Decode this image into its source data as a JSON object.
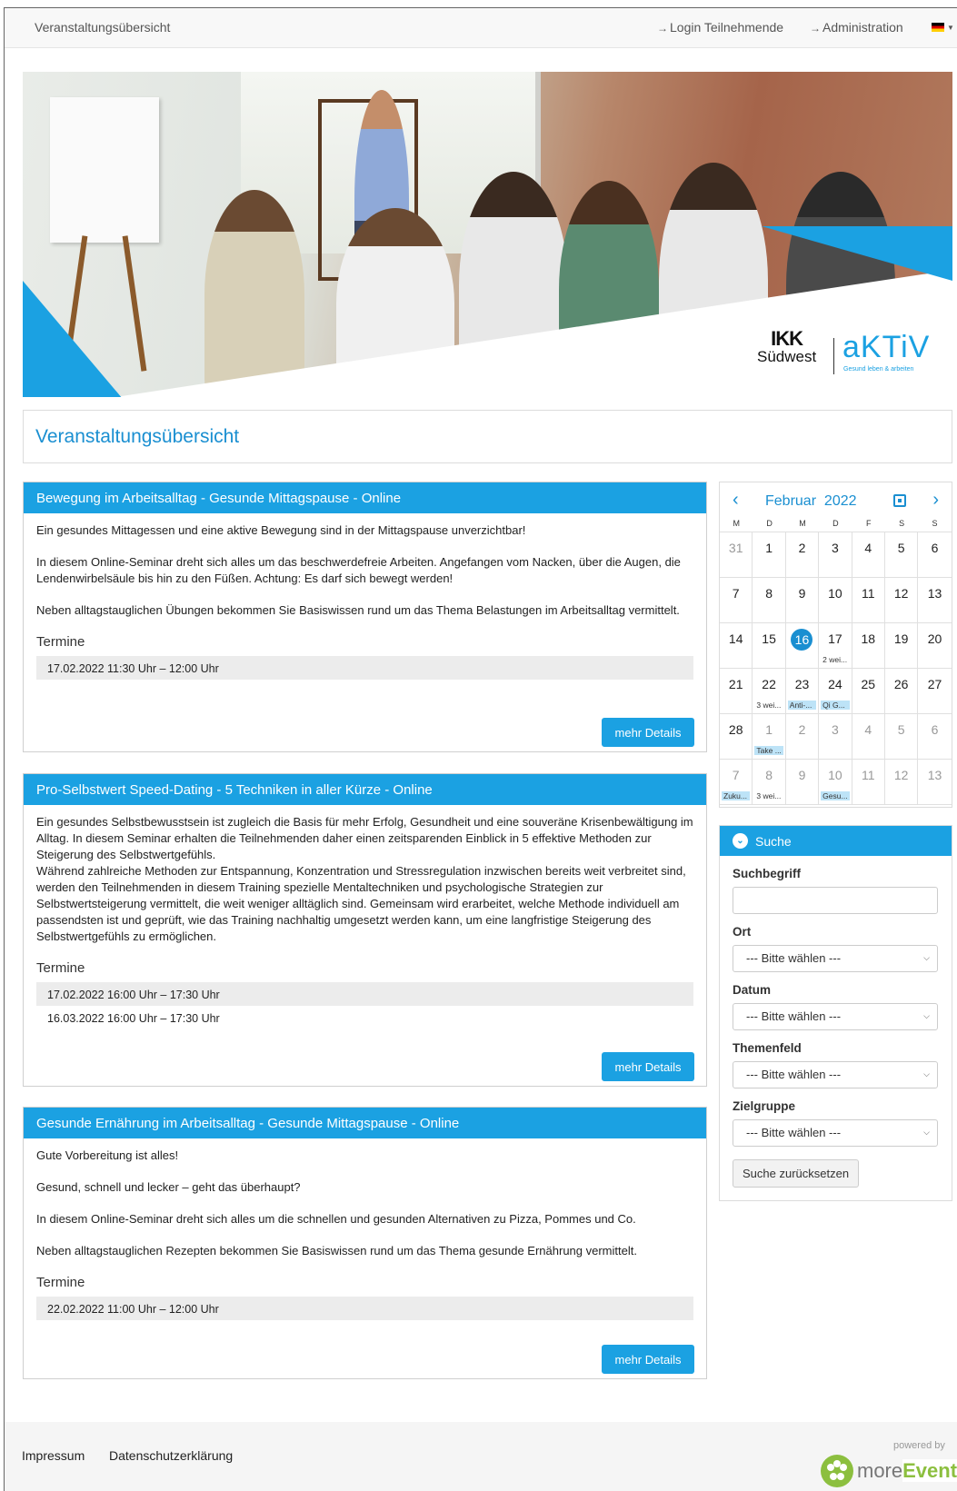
{
  "nav": {
    "brand": "Veranstaltungsübersicht",
    "login": "Login Teilnehmende",
    "admin": "Administration"
  },
  "hero": {
    "logo_ikk": "IKK",
    "logo_sudwest": "Südwest",
    "logo_aktiv": "aKTiV",
    "logo_tagline": "Gesund leben & arbeiten"
  },
  "page_title": "Veranstaltungsübersicht",
  "events": [
    {
      "title": "Bewegung im Arbeitsalltag - Gesunde Mittagspause - Online",
      "paragraphs": [
        "Ein gesundes Mittagessen und eine aktive Bewegung sind in der Mittagspause unverzichtbar!",
        "In diesem Online-Seminar dreht sich alles um das beschwerdefreie Arbeiten. Angefangen vom Nacken, über die Augen, die Lendenwirbelsäule bis hin zu den Füßen. Achtung: Es darf sich bewegt werden!",
        "Neben alltagstauglichen Übungen bekommen Sie Basiswissen rund um das Thema Belastungen im Arbeitsalltag vermittelt."
      ],
      "termine_label": "Termine",
      "termine": [
        "17.02.2022 11:30 Uhr – 12:00 Uhr"
      ],
      "button": "mehr Details"
    },
    {
      "title": "Pro-Selbstwert Speed-Dating - 5 Techniken in aller Kürze - Online",
      "paragraphs": [
        "Ein gesundes Selbstbewusstsein ist zugleich die Basis für mehr Erfolg, Gesundheit und eine souveräne Krisenbewältigung im Alltag. In diesem Seminar erhalten die Teilnehmenden daher einen zeitsparenden Einblick in 5 effektive Methoden zur Steigerung des Selbstwertgefühls.",
        "Während zahlreiche Methoden zur Entspannung, Konzentration und Stressregulation inzwischen bereits weit verbreitet sind, werden den Teilnehmenden in diesem Training spezielle Mentaltechniken und psychologische Strategien zur Selbstwertsteigerung vermittelt, die weit weniger alltäglich sind. Gemeinsam wird erarbeitet, welche Methode individuell am passendsten ist und geprüft, wie das Training nachhaltig umgesetzt werden kann, um eine langfristige Steigerung des Selbstwertgefühls zu ermöglichen."
      ],
      "termine_label": "Termine",
      "termine": [
        "17.02.2022 16:00 Uhr – 17:30 Uhr",
        "16.03.2022 16:00 Uhr – 17:30 Uhr"
      ],
      "button": "mehr Details"
    },
    {
      "title": "Gesunde Ernährung im Arbeitsalltag - Gesunde Mittagspause - Online",
      "paragraphs": [
        "Gute Vorbereitung ist alles!",
        "Gesund, schnell und lecker – geht das überhaupt?",
        "In diesem Online-Seminar dreht sich alles um die schnellen und gesunden Alternativen zu Pizza, Pommes und Co.",
        "Neben alltagstauglichen Rezepten bekommen Sie Basiswissen rund um das Thema gesunde Ernährung vermittelt."
      ],
      "termine_label": "Termine",
      "termine": [
        "22.02.2022 11:00 Uhr – 12:00 Uhr"
      ],
      "button": "mehr Details"
    }
  ],
  "calendar": {
    "month": "Februar",
    "year": "2022",
    "weekdays": [
      "M",
      "D",
      "M",
      "D",
      "F",
      "S",
      "S"
    ],
    "weeks": [
      [
        {
          "d": "31",
          "o": true
        },
        {
          "d": "1"
        },
        {
          "d": "2"
        },
        {
          "d": "3"
        },
        {
          "d": "4"
        },
        {
          "d": "5"
        },
        {
          "d": "6"
        }
      ],
      [
        {
          "d": "7"
        },
        {
          "d": "8"
        },
        {
          "d": "9"
        },
        {
          "d": "10"
        },
        {
          "d": "11"
        },
        {
          "d": "12"
        },
        {
          "d": "13"
        }
      ],
      [
        {
          "d": "14"
        },
        {
          "d": "15"
        },
        {
          "d": "16",
          "today": true
        },
        {
          "d": "17",
          "ev": "2 wei...",
          "evc": "plain"
        },
        {
          "d": "18"
        },
        {
          "d": "19"
        },
        {
          "d": "20"
        }
      ],
      [
        {
          "d": "21"
        },
        {
          "d": "22",
          "ev": "3 wei...",
          "evc": "plain"
        },
        {
          "d": "23",
          "ev": "Anti-...",
          "evc": "blue"
        },
        {
          "d": "24",
          "ev": "Qi G...",
          "evc": "blue"
        },
        {
          "d": "25"
        },
        {
          "d": "26"
        },
        {
          "d": "27"
        }
      ],
      [
        {
          "d": "28"
        },
        {
          "d": "1",
          "o": true,
          "ev": "Take ...",
          "evc": "blue"
        },
        {
          "d": "2",
          "o": true
        },
        {
          "d": "3",
          "o": true
        },
        {
          "d": "4",
          "o": true
        },
        {
          "d": "5",
          "o": true
        },
        {
          "d": "6",
          "o": true
        }
      ],
      [
        {
          "d": "7",
          "o": true,
          "ev": "Zuku...",
          "evc": "blue"
        },
        {
          "d": "8",
          "o": true,
          "ev": "3 wei...",
          "evc": "plain"
        },
        {
          "d": "9",
          "o": true
        },
        {
          "d": "10",
          "o": true,
          "ev": "Gesu...",
          "evc": "blue"
        },
        {
          "d": "11",
          "o": true
        },
        {
          "d": "12",
          "o": true
        },
        {
          "d": "13",
          "o": true
        }
      ]
    ]
  },
  "search": {
    "title": "Suche",
    "term_label": "Suchbegriff",
    "term_value": "",
    "ort_label": "Ort",
    "datum_label": "Datum",
    "themenfeld_label": "Themenfeld",
    "zielgruppe_label": "Zielgruppe",
    "select_placeholder": "--- Bitte wählen ---",
    "reset_button": "Suche zurücksetzen"
  },
  "footer": {
    "impressum": "Impressum",
    "datenschutz": "Datenschutzerklärung",
    "powered_by": "powered by",
    "logo_more": "more",
    "logo_event": "Event"
  },
  "colors": {
    "primary": "#1ba1e2",
    "heading": "#1a8fd1",
    "moreevent_green": "#8cbf3f"
  }
}
